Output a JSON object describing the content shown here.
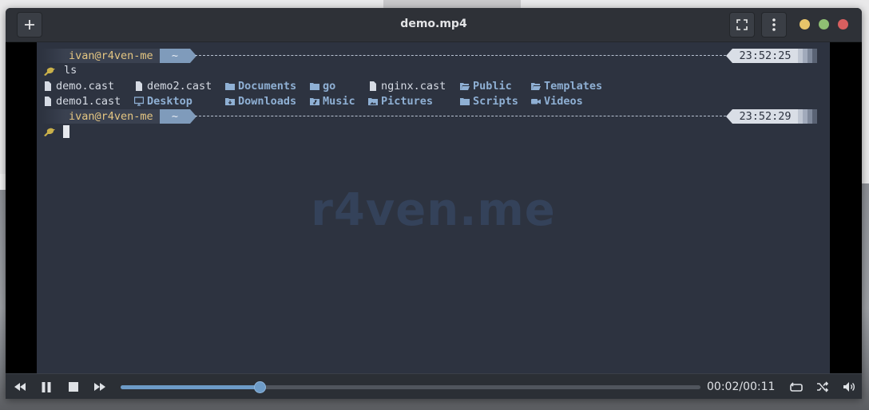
{
  "window": {
    "title": "demo.mp4"
  },
  "terminal": {
    "prompts": [
      {
        "user": "ivan@r4ven-me",
        "dir": "~",
        "time": "23:52:25",
        "command": "ls"
      },
      {
        "user": "ivan@r4ven-me",
        "dir": "~",
        "time": "23:52:29",
        "command": ""
      }
    ],
    "ls_row1": [
      {
        "name": "demo.cast",
        "kind": "file"
      },
      {
        "name": "demo2.cast",
        "kind": "file"
      },
      {
        "name": "Documents",
        "kind": "dir"
      },
      {
        "name": "go",
        "kind": "dir"
      },
      {
        "name": "nginx.cast",
        "kind": "file"
      },
      {
        "name": "Public",
        "kind": "dir"
      },
      {
        "name": "Templates",
        "kind": "dir"
      }
    ],
    "ls_row2": [
      {
        "name": "demo1.cast",
        "kind": "file"
      },
      {
        "name": "Desktop",
        "kind": "dir"
      },
      {
        "name": "Downloads",
        "kind": "dir"
      },
      {
        "name": "Music",
        "kind": "dir"
      },
      {
        "name": "Pictures",
        "kind": "dir"
      },
      {
        "name": "Scripts",
        "kind": "dir"
      },
      {
        "name": "Videos",
        "kind": "dir"
      }
    ],
    "watermark": "r4ven.me"
  },
  "player": {
    "timecode": "00:02/00:11",
    "progress_fraction": 0.24
  },
  "colors": {
    "accent": "#6d9bc7",
    "prompt_user": "#e4c682",
    "dir_text": "#8fb0d4"
  }
}
